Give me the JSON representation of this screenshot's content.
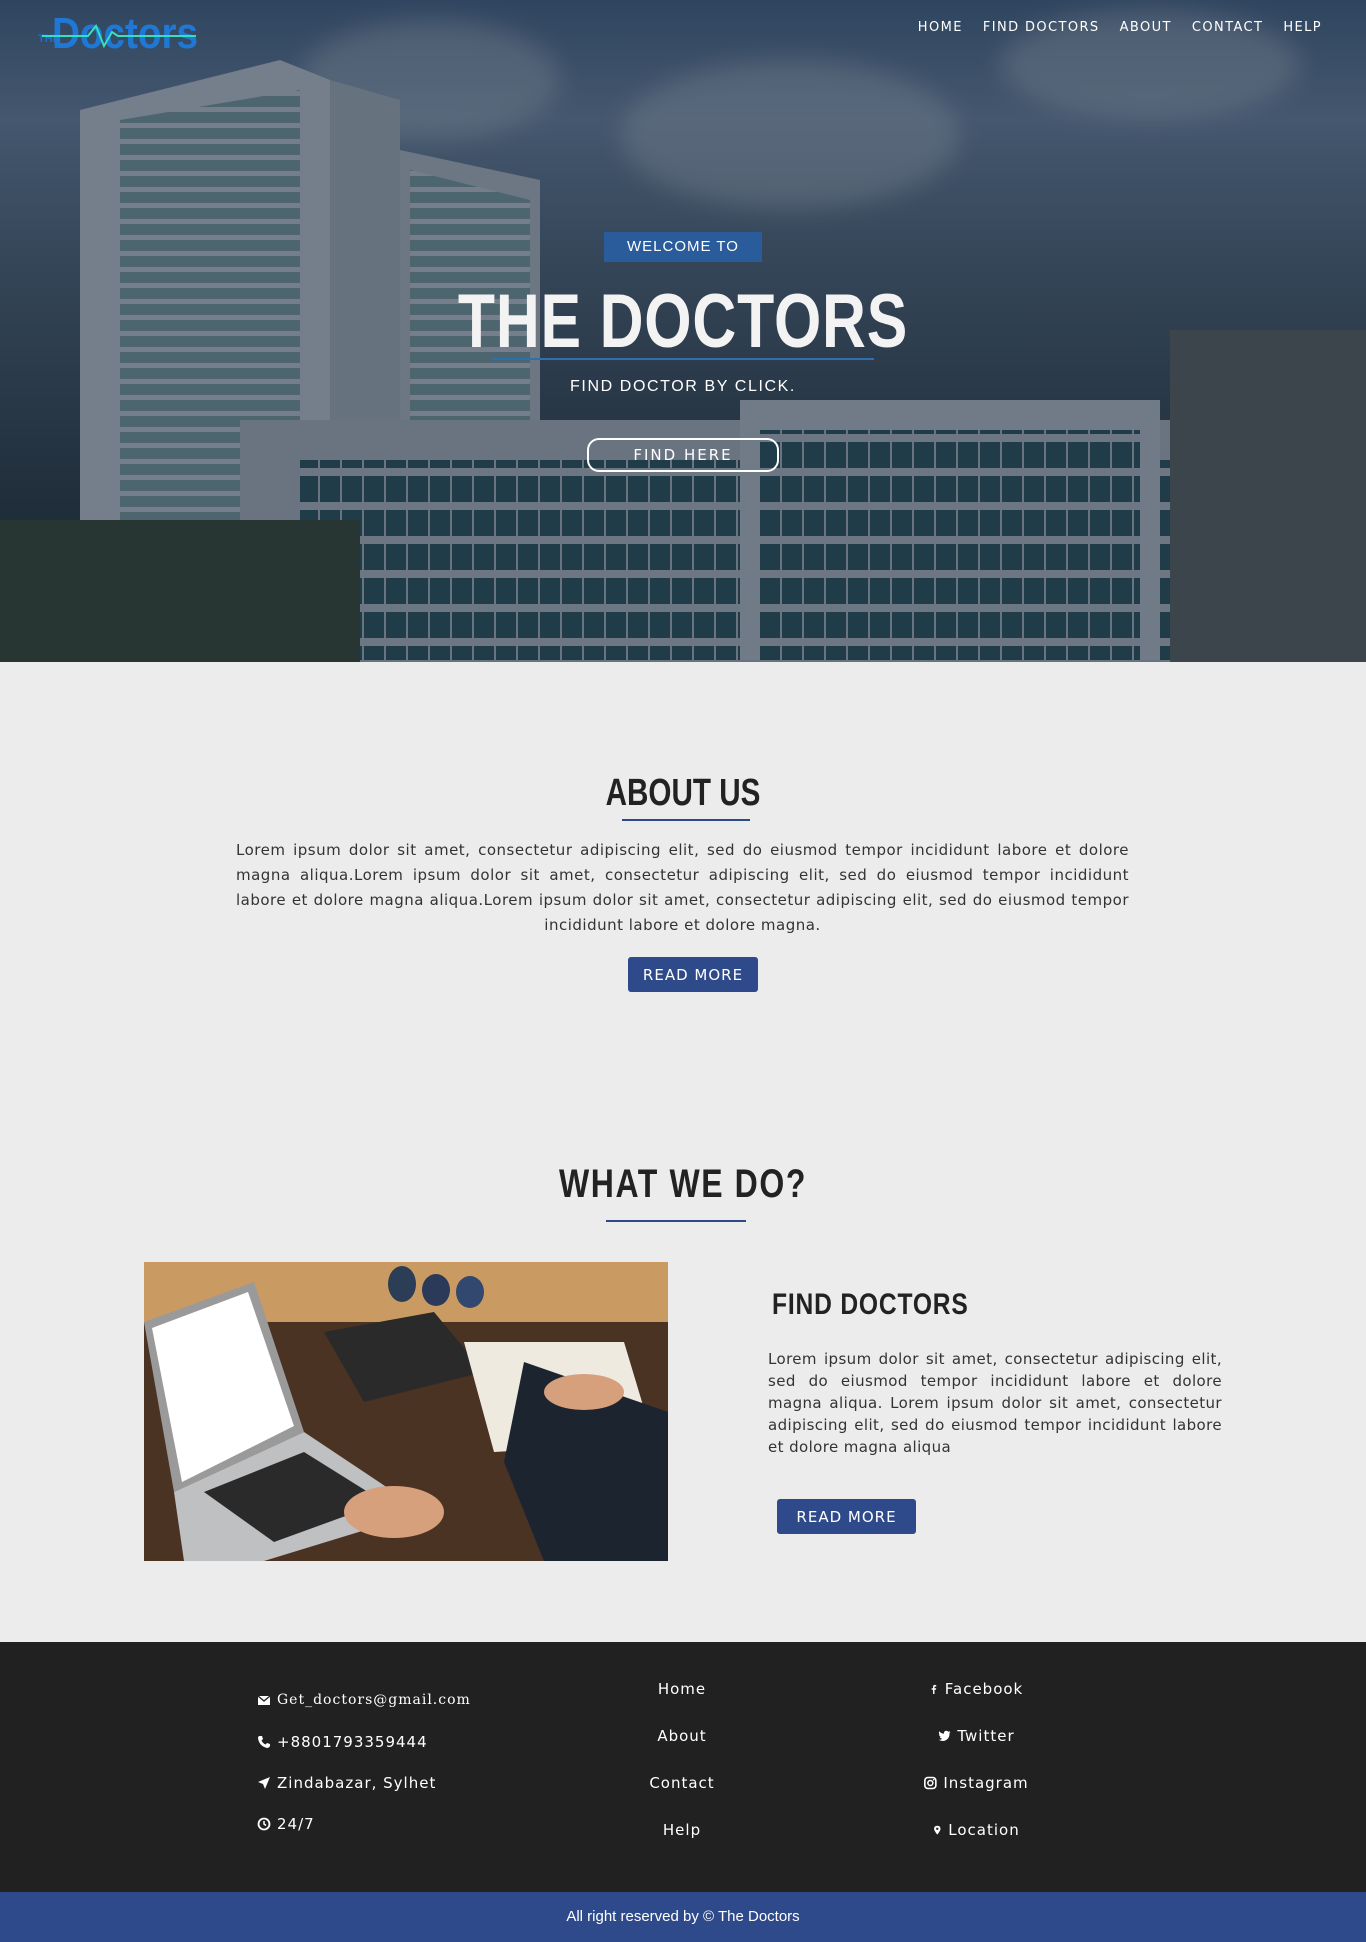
{
  "header": {
    "logo_text": "The Doctors",
    "nav": [
      "HOME",
      "FIND DOCTORS",
      "ABOUT",
      "CONTACT",
      "HELP"
    ]
  },
  "hero": {
    "badge": "WELCOME TO",
    "title": "THE DOCTORS",
    "subtitle": "FIND DOCTOR BY CLICK.",
    "button": "FIND HERE"
  },
  "about": {
    "title": "ABOUT US",
    "text": "Lorem ipsum dolor sit amet, consectetur adipiscing elit, sed do eiusmod tempor incididunt labore et dolore magna aliqua.Lorem ipsum dolor sit amet, consectetur adipiscing elit, sed do eiusmod tempor incididunt labore et dolore magna aliqua.Lorem ipsum dolor sit amet, consectetur adipiscing elit, sed do eiusmod tempor incididunt labore et dolore magna.",
    "button": "READ MORE"
  },
  "what": {
    "title": "WHAT WE DO?",
    "card_title": "FIND DOCTORS",
    "card_text": "Lorem ipsum dolor sit amet, consectetur adipiscing elit, sed do eiusmod tempor incididunt labore et dolore magna aliqua. Lorem ipsum dolor sit amet, consectetur adipiscing elit, sed do eiusmod tempor incididunt labore et dolore magna aliqua",
    "button": "READ MORE"
  },
  "footer": {
    "contact": {
      "email": "Get_doctors@gmail.com",
      "phone": "+8801793359444",
      "address": "Zindabazar, Sylhet",
      "hours": "24/7"
    },
    "links": [
      "Home",
      "About",
      "Contact",
      "Help"
    ],
    "social": [
      "Facebook",
      "Twitter",
      "Instagram",
      "Location"
    ],
    "copyright": "All right reserved by © The Doctors"
  },
  "colors": {
    "accent": "#2e4a8b",
    "badge": "#2a5b9a",
    "footer_bg": "#212121",
    "page_bg": "#ececec"
  }
}
